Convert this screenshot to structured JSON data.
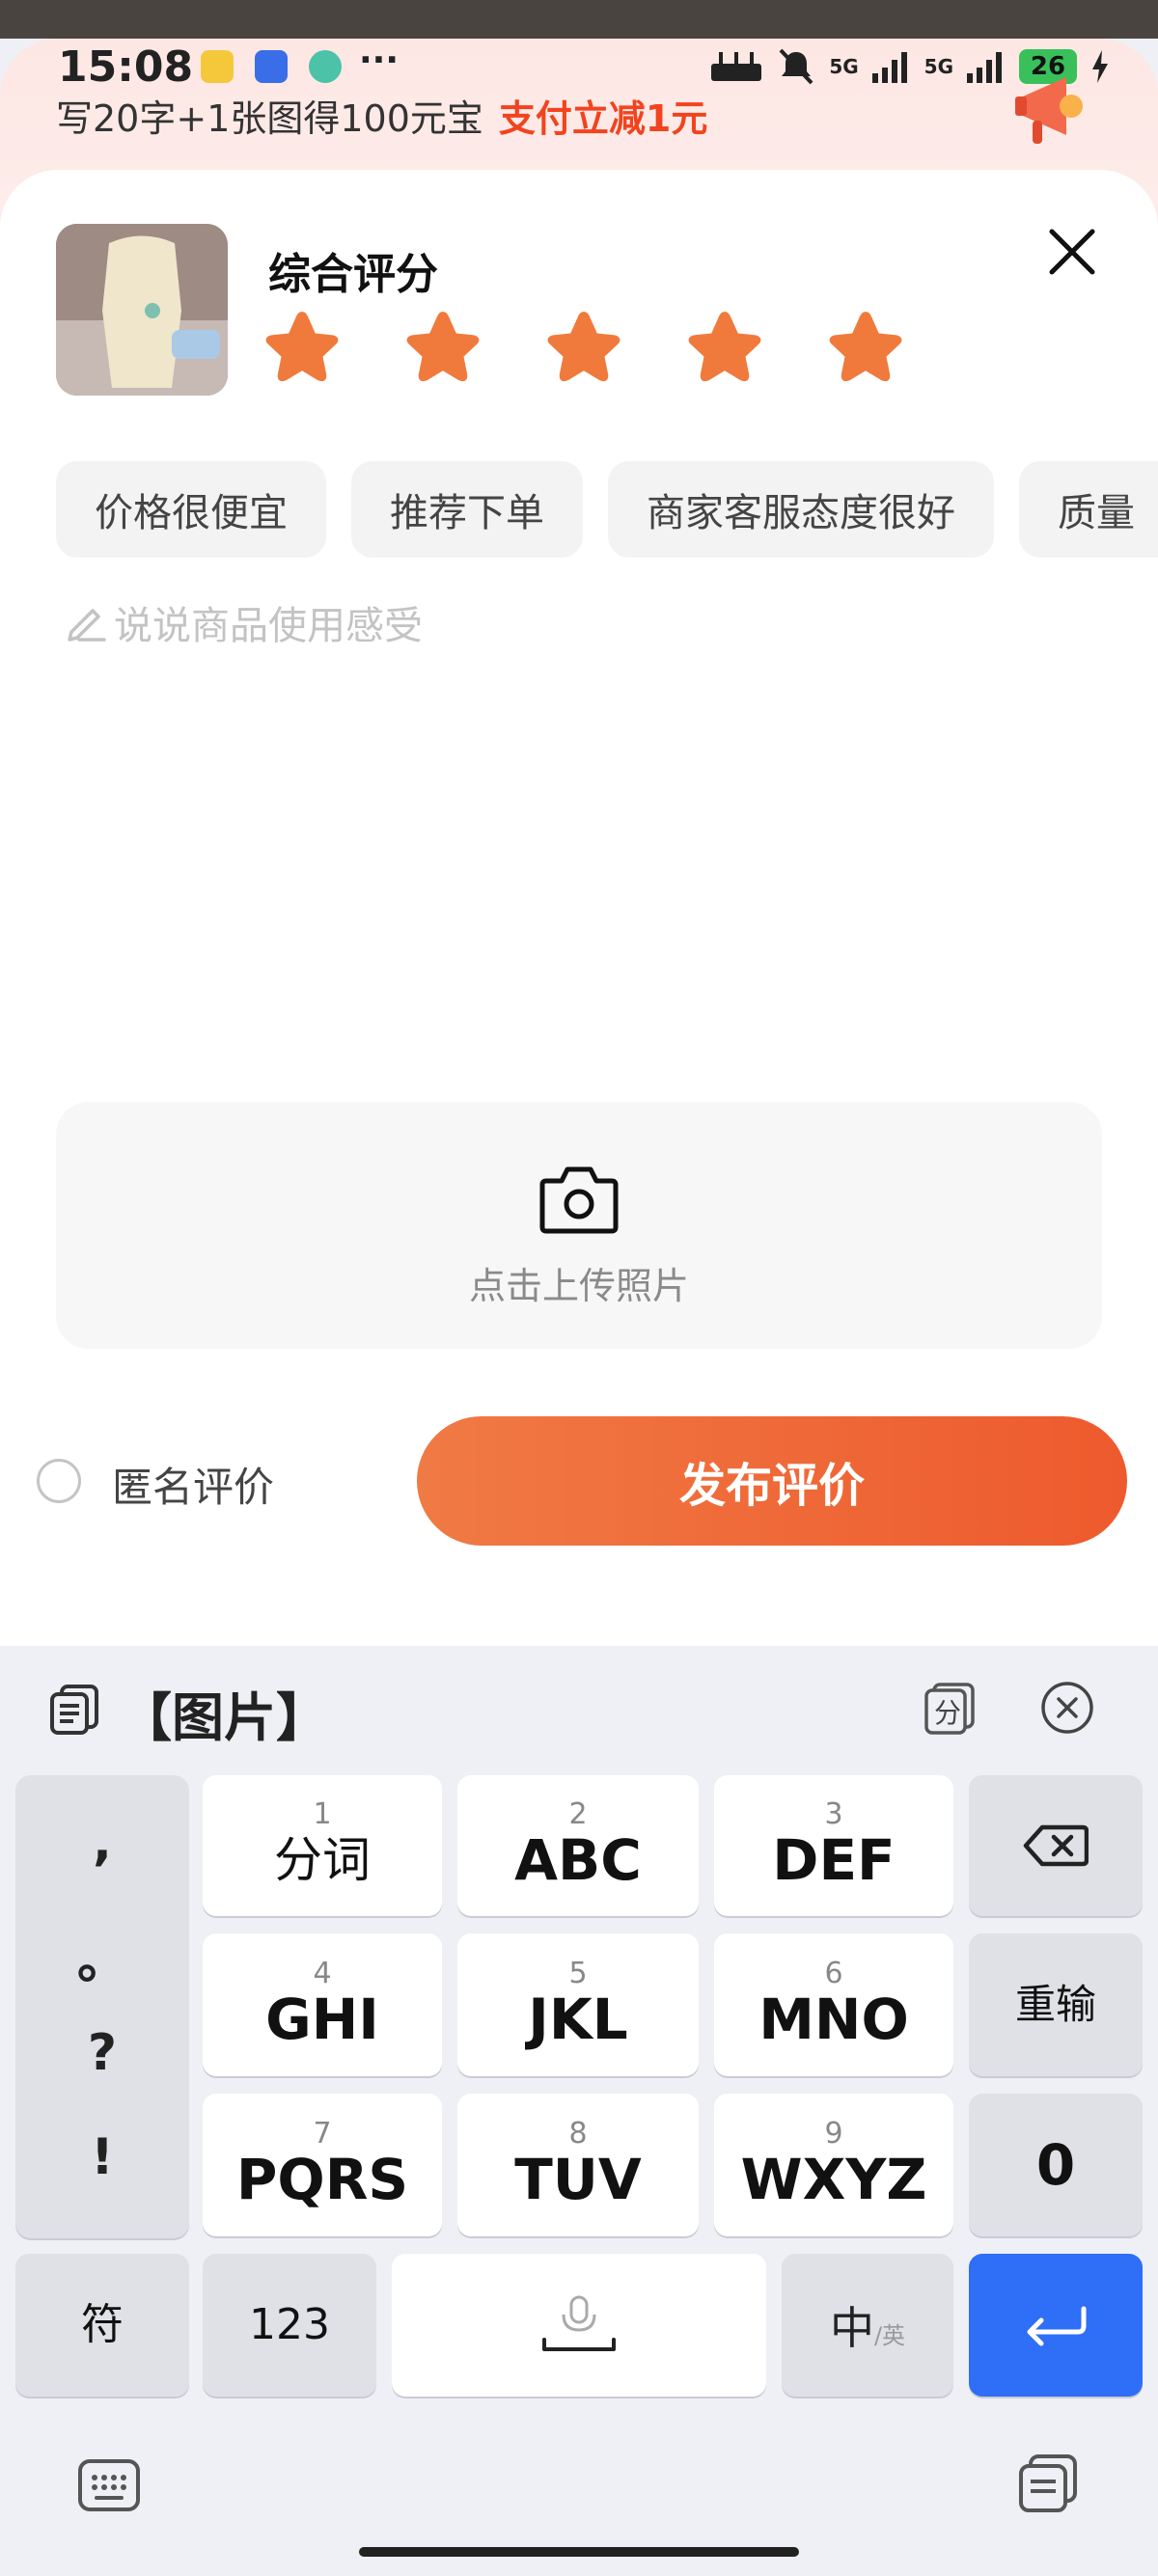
{
  "status_bar": {
    "time": "15:08",
    "more": "···",
    "network_1": "5G",
    "network_2": "5G",
    "battery": "26"
  },
  "promo": {
    "text": "写20字+1张图得100元宝",
    "highlight": "支付立减1元"
  },
  "review": {
    "rating_title": "综合评分",
    "stars": 5,
    "tags": [
      "价格很便宜",
      "推荐下单",
      "商家客服态度很好",
      "质量"
    ],
    "placeholder": "说说商品使用感受",
    "upload_text": "点击上传照片",
    "anonymous_label": "匿名评价",
    "publish_label": "发布评价"
  },
  "keyboard": {
    "candidate_text": "【图片】",
    "split_icon_label": "分",
    "punct": [
      ",",
      "。",
      "?",
      "!"
    ],
    "keys": [
      {
        "num": "1",
        "label": "分词"
      },
      {
        "num": "2",
        "label": "ABC"
      },
      {
        "num": "3",
        "label": "DEF"
      },
      {
        "num": "4",
        "label": "GHI"
      },
      {
        "num": "5",
        "label": "JKL"
      },
      {
        "num": "6",
        "label": "MNO"
      },
      {
        "num": "7",
        "label": "PQRS"
      },
      {
        "num": "8",
        "label": "TUV"
      },
      {
        "num": "9",
        "label": "WXYZ"
      }
    ],
    "reset_label": "重输",
    "zero_label": "0",
    "symbol_label": "符",
    "num_label": "123",
    "lang_main": "中",
    "lang_sub": "/英"
  },
  "colors": {
    "accent": "#ee5a2d",
    "star": "#f07a3c",
    "enter_key": "#2f6ef6"
  }
}
